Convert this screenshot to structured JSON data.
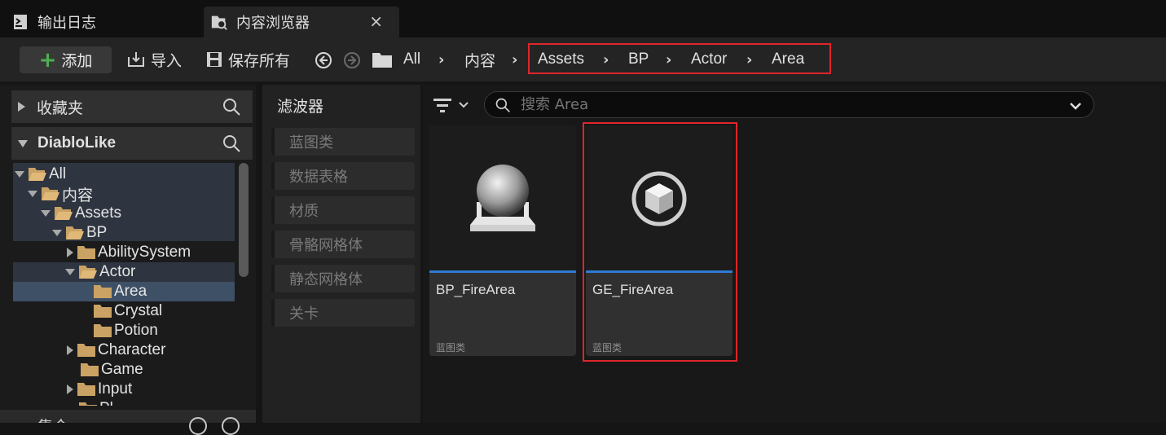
{
  "tabs": {
    "output_log": "输出日志",
    "content_browser": "内容浏览器",
    "close": "×"
  },
  "toolbar": {
    "add": "添加",
    "import": "导入",
    "save_all": "保存所有",
    "breadcrumbs": [
      "All",
      "内容",
      "Assets",
      "BP",
      "Actor",
      "Area"
    ],
    "separator": "›"
  },
  "left": {
    "favorites": "收藏夹",
    "project": "DiabloLike",
    "tree": [
      {
        "label": "All",
        "expanded": true
      },
      {
        "label": "内容",
        "expanded": true
      },
      {
        "label": "Assets",
        "expanded": true
      },
      {
        "label": "BP",
        "expanded": true
      },
      {
        "label": "AbilitySystem",
        "expanded": false
      },
      {
        "label": "Actor",
        "expanded": true
      },
      {
        "label": "Area",
        "selected": true
      },
      {
        "label": "Crystal"
      },
      {
        "label": "Potion"
      },
      {
        "label": "Character",
        "expanded": false
      },
      {
        "label": "Game"
      },
      {
        "label": "Input",
        "expanded": false
      },
      {
        "label": "Pl"
      }
    ],
    "collections": "集合"
  },
  "filters": {
    "title": "滤波器",
    "items": [
      "蓝图类",
      "数据表格",
      "材质",
      "骨骼网格体",
      "静态网格体",
      "关卡"
    ]
  },
  "content": {
    "search_placeholder": "搜索 Area",
    "assets": [
      {
        "name": "BP_FireArea",
        "type": "蓝图类",
        "icon": "sphere-on-pedestal-icon"
      },
      {
        "name": "GE_FireArea",
        "type": "蓝图类",
        "icon": "cube-in-circle-icon"
      }
    ]
  },
  "colors": {
    "highlight_red": "#e0252b",
    "accent_blue": "#2e7bd6",
    "add_green": "#4caf50",
    "folder": "#c9a264"
  }
}
